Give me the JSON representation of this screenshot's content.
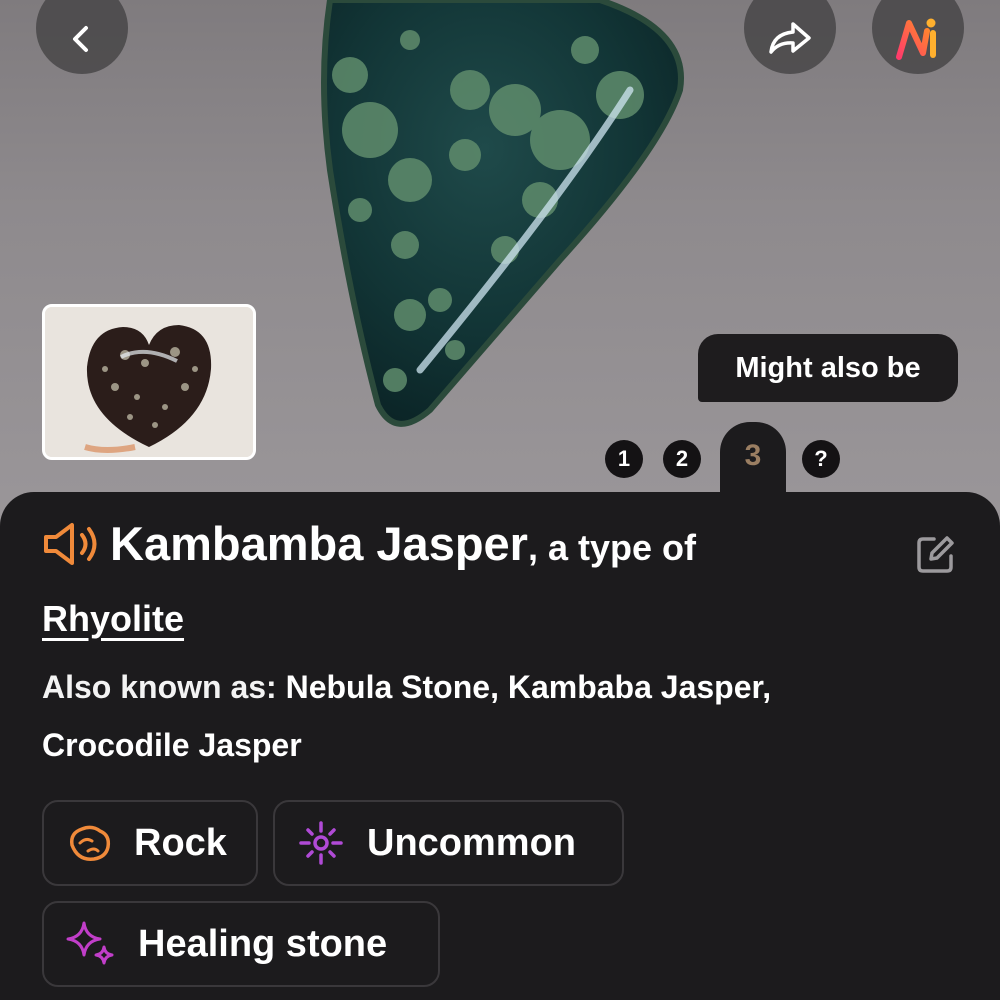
{
  "photo": {
    "page_indicator": {
      "pages": [
        "1",
        "2",
        "3",
        "?"
      ],
      "active": "3"
    },
    "might_also_be": "Might also be"
  },
  "sheet": {
    "name": "Kambamba Jasper",
    "type_of_prefix": ", a type of",
    "parent": "Rhyolite",
    "also_known_as_label": "Also known as:",
    "also_known_as": "Nebula Stone, Kambaba Jasper, Crocodile Jasper",
    "chips": [
      {
        "label": "Rock",
        "icon": "rock-icon"
      },
      {
        "label": "Uncommon",
        "icon": "sparkle-sun-icon"
      },
      {
        "label": "Healing stone",
        "icon": "healing-sparkle-icon"
      }
    ]
  },
  "colors": {
    "sheet_bg": "#1c1b1d",
    "accent_orange": "#f08a3a",
    "accent_purple": "#b04ad6",
    "accent_pink": "#c13ec9",
    "tab_active_text": "#9a7e62"
  }
}
